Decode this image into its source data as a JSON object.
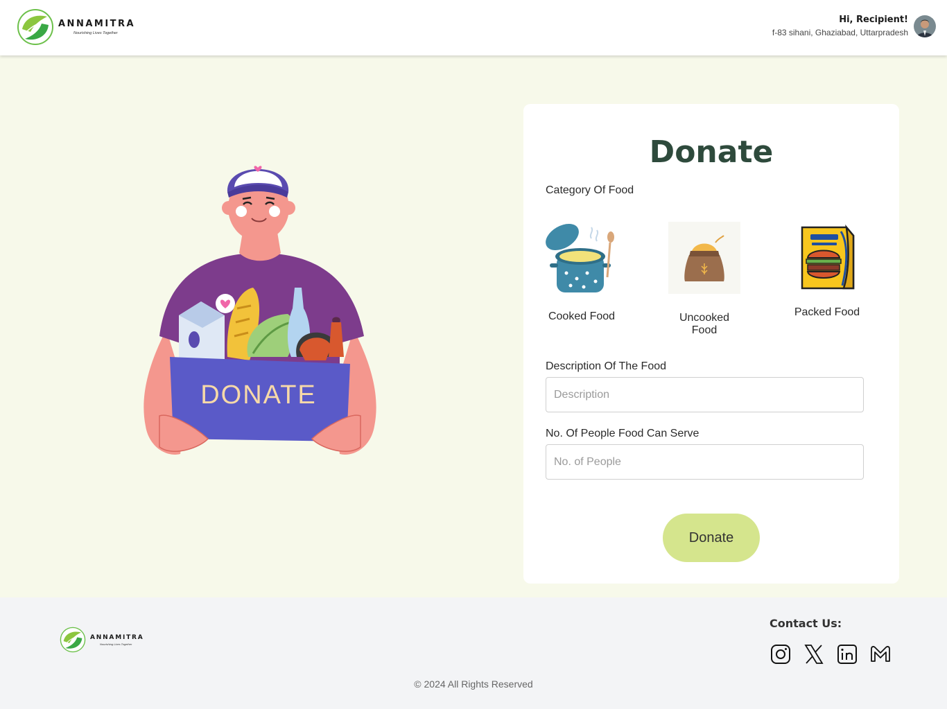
{
  "header": {
    "brand_name": "ANNAMITRA",
    "brand_tagline": "Nourishing Lives Together",
    "user_greeting": "Hi, Recipient!",
    "user_address": "f-83 sihani, Ghaziabad, Uttarpradesh"
  },
  "illustration": {
    "box_text": "DONATE"
  },
  "form": {
    "title": "Donate",
    "category_label": "Category Of Food",
    "categories": [
      {
        "label": "Cooked Food",
        "icon": "cooking-pot-icon"
      },
      {
        "label": "Uncooked Food",
        "icon": "grain-sack-icon"
      },
      {
        "label": "Packed Food",
        "icon": "packed-bag-icon"
      }
    ],
    "description_label": "Description Of The Food",
    "description_placeholder": "Description",
    "people_label": "No. Of People Food Can Serve",
    "people_placeholder": "No. of People",
    "submit_label": "Donate"
  },
  "footer": {
    "brand_name": "ANNAMITRA",
    "brand_tagline": "Nourishing Lives Together",
    "contact_title": "Contact Us:",
    "socials": [
      "instagram-icon",
      "x-icon",
      "linkedin-icon",
      "gmail-icon"
    ],
    "copyright": "© 2024 All Rights Reserved"
  },
  "colors": {
    "page_bg": "#f7f9ea",
    "title": "#2e4a3c",
    "button": "#d5e58d",
    "footer_bg": "#f3f4f6"
  }
}
